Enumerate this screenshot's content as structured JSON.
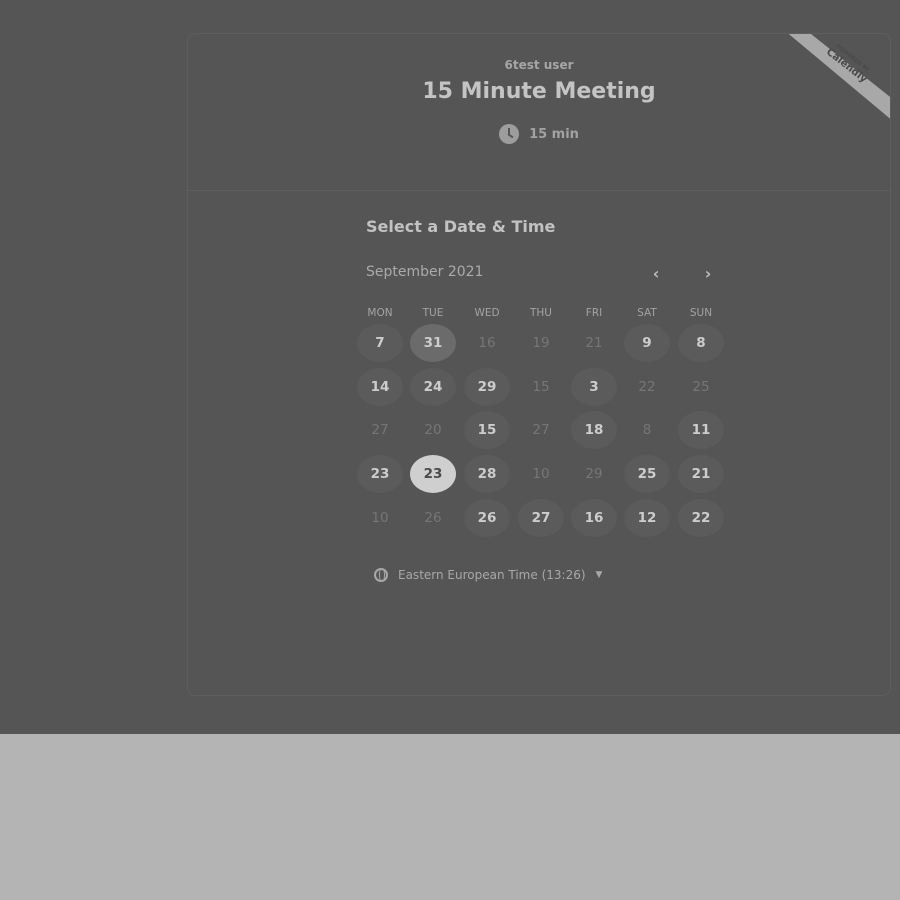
{
  "header": {
    "host_name": "6test user",
    "event_title": "15 Minute Meeting",
    "duration": "15 min",
    "icon": "clock-icon"
  },
  "ribbon": {
    "line1": "POWERED BY",
    "line2": "Calendly"
  },
  "calendar": {
    "section_title": "Select a Date & Time",
    "month_label": "September 2021",
    "prev_icon": "chevron-left-icon",
    "next_icon": "chevron-right-icon",
    "weekdays": [
      "MON",
      "TUE",
      "WED",
      "THU",
      "FRI",
      "SAT",
      "SUN"
    ],
    "rows": [
      [
        {
          "label": "7",
          "state": "avail"
        },
        {
          "label": "31",
          "state": "today"
        },
        {
          "label": "16",
          "state": "unavail"
        },
        {
          "label": "19",
          "state": "unavail"
        },
        {
          "label": "21",
          "state": "unavail"
        },
        {
          "label": "9",
          "state": "avail"
        },
        {
          "label": "8",
          "state": "avail"
        }
      ],
      [
        {
          "label": "14",
          "state": "avail"
        },
        {
          "label": "24",
          "state": "avail"
        },
        {
          "label": "29",
          "state": "avail"
        },
        {
          "label": "15",
          "state": "unavail"
        },
        {
          "label": "3",
          "state": "avail"
        },
        {
          "label": "22",
          "state": "unavail"
        },
        {
          "label": "25",
          "state": "unavail"
        }
      ],
      [
        {
          "label": "27",
          "state": "unavail"
        },
        {
          "label": "20",
          "state": "unavail"
        },
        {
          "label": "15",
          "state": "avail"
        },
        {
          "label": "27",
          "state": "unavail"
        },
        {
          "label": "18",
          "state": "avail"
        },
        {
          "label": "8",
          "state": "unavail"
        },
        {
          "label": "11",
          "state": "avail"
        }
      ],
      [
        {
          "label": "23",
          "state": "avail"
        },
        {
          "label": "23",
          "state": "selected"
        },
        {
          "label": "28",
          "state": "avail"
        },
        {
          "label": "10",
          "state": "unavail"
        },
        {
          "label": "29",
          "state": "unavail"
        },
        {
          "label": "25",
          "state": "avail"
        },
        {
          "label": "21",
          "state": "avail"
        }
      ],
      [
        {
          "label": "10",
          "state": "unavail"
        },
        {
          "label": "26",
          "state": "unavail"
        },
        {
          "label": "26",
          "state": "avail"
        },
        {
          "label": "27",
          "state": "avail"
        },
        {
          "label": "16",
          "state": "avail"
        },
        {
          "label": "12",
          "state": "avail"
        },
        {
          "label": "22",
          "state": "avail"
        }
      ]
    ]
  },
  "timezone": {
    "label": "Eastern European Time (13:26)",
    "icon": "globe-icon",
    "caret_icon": "caret-down-icon"
  }
}
